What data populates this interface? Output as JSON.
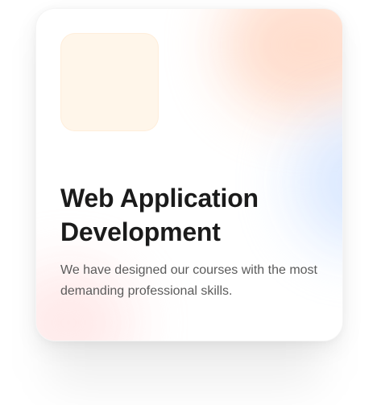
{
  "card": {
    "title": "Web Application Development",
    "description": "We have designed our courses with the most demanding professional skills."
  }
}
